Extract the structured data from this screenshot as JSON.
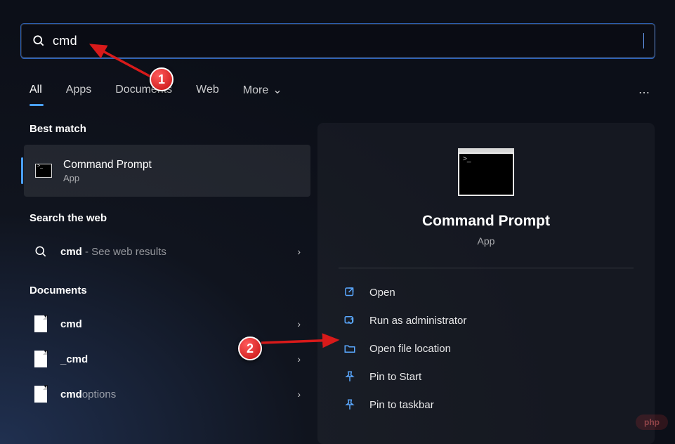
{
  "search": {
    "value": "cmd"
  },
  "tabs": [
    "All",
    "Apps",
    "Documents",
    "Web",
    "More"
  ],
  "more_icon": "⋯",
  "sections": {
    "best": "Best match",
    "web": "Search the web",
    "docs": "Documents"
  },
  "best_match": {
    "title": "Command Prompt",
    "subtitle": "App"
  },
  "web_result": {
    "bold": "cmd",
    "rest": " - See web results"
  },
  "doc_results": [
    {
      "bold": "cmd",
      "rest": ""
    },
    {
      "pre": "_",
      "bold": "cmd",
      "rest": ""
    },
    {
      "bold": "cmd",
      "rest": "options"
    }
  ],
  "preview": {
    "title": "Command Prompt",
    "subtitle": "App",
    "actions": [
      {
        "icon": "open",
        "label": "Open"
      },
      {
        "icon": "admin",
        "label": "Run as administrator"
      },
      {
        "icon": "folder",
        "label": "Open file location"
      },
      {
        "icon": "pin",
        "label": "Pin to Start"
      },
      {
        "icon": "pin",
        "label": "Pin to taskbar"
      }
    ]
  },
  "markers": {
    "one": "1",
    "two": "2"
  },
  "watermark": "php"
}
